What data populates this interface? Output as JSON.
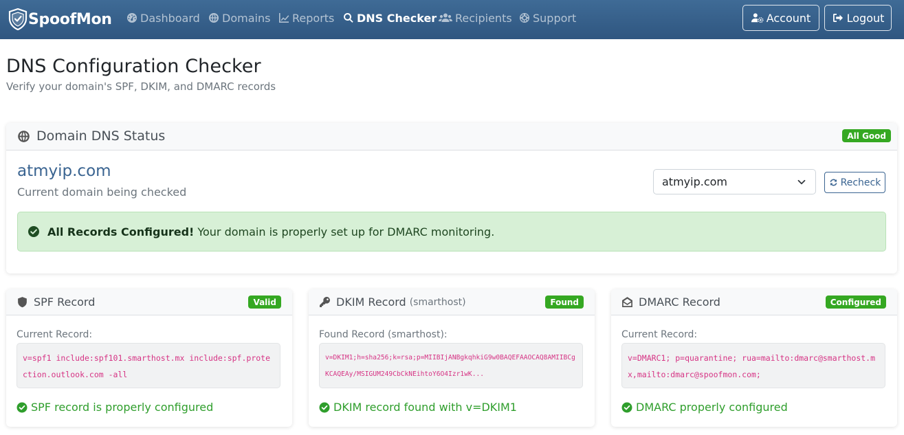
{
  "nav": {
    "brand": "SpoofMon",
    "items": [
      {
        "label": "Dashboard"
      },
      {
        "label": "Domains"
      },
      {
        "label": "Reports"
      },
      {
        "label": "DNS Checker"
      },
      {
        "label": "Recipients"
      },
      {
        "label": "Support"
      }
    ],
    "account_label": "Account",
    "logout_label": "Logout"
  },
  "page": {
    "title": "DNS Configuration Checker",
    "subtitle": "Verify your domain's SPF, DKIM, and DMARC records"
  },
  "status_card": {
    "title": "Domain DNS Status",
    "badge": "All Good",
    "domain": "atmyip.com",
    "caption": "Current domain being checked",
    "select_value": "atmyip.com",
    "recheck_label": "Recheck",
    "alert_strong": "All Records Configured!",
    "alert_text": "Your domain is properly set up for DMARC monitoring."
  },
  "records": [
    {
      "title": "SPF Record",
      "subtitle": "",
      "badge": "Valid",
      "label": "Current Record:",
      "value": "v=spf1 include:spf101.smarthost.mx include:spf.protection.outlook.com -all",
      "status": "SPF record is properly configured"
    },
    {
      "title": "DKIM Record",
      "subtitle": "(smarthost)",
      "badge": "Found",
      "label": "Found Record (smarthost):",
      "value": "v=DKIM1;h=sha256;k=rsa;p=MIIBIjANBgkqhkiG9w0BAQEFAAOCAQ8AMIIBCgKCAQEAy/MSIGUM249CbCkNEihtoY6O4Izr1wK...",
      "status": "DKIM record found with v=DKIM1"
    },
    {
      "title": "DMARC Record",
      "subtitle": "",
      "badge": "Configured",
      "label": "Current Record:",
      "value": "v=DMARC1; p=quarantine; rua=mailto:dmarc@smarthost.mx,mailto:dmarc@spoofmon.com;",
      "status": "DMARC properly configured"
    }
  ],
  "colors": {
    "navbar": "#3a6491",
    "success": "#35a822",
    "code": "#d63384",
    "link": "#3a6491"
  }
}
